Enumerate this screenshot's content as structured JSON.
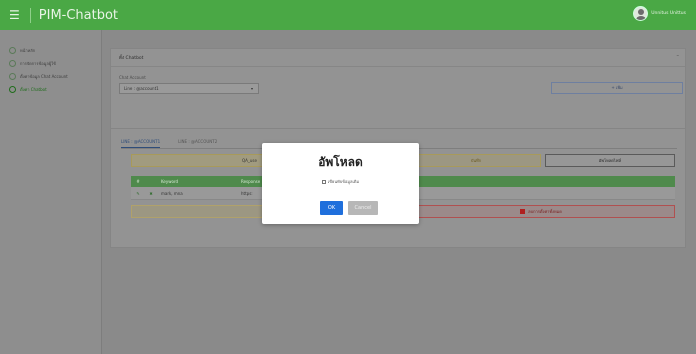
{
  "topbar": {
    "menu_icon": "☰",
    "brand": "PIM-Chatbot",
    "user_name": "Unnitus Unittus"
  },
  "sidebar": {
    "items": [
      {
        "label": "หน้าหลัก",
        "icon": "home-icon"
      },
      {
        "label": "การจัดการข้อมูลผู้ใช้",
        "icon": "users-icon"
      },
      {
        "label": "ตั้งค่าข้อมูล Chat Account",
        "icon": "settings-icon"
      },
      {
        "label": "ตั้งค่า Chatbot",
        "icon": "settings-icon"
      }
    ]
  },
  "card1": {
    "title": "ตั้ง Chatbot",
    "collapse": "–",
    "account_label": "Chat Account",
    "account_value": "Line : @account1",
    "account_chevron": "▾",
    "add_button": "+ เพิ่ม"
  },
  "card2": {
    "tabs": [
      "LINE : @ACCOUNT1",
      "LINE : @ACCOUNT2"
    ],
    "qa_label": "QA_use",
    "save_top": "บันทึก",
    "upload_top": "อัพโหลดไฟล์",
    "table": {
      "headers": [
        "#",
        "",
        "Keyword",
        "Response"
      ],
      "rows": [
        {
          "edit": "✎",
          "del": "✖",
          "keyword": "mark, mna",
          "response": "https:"
        }
      ]
    },
    "save_bottom": "บันทึก",
    "delete_button": "ลบการตั้งค่าทั้งหมด"
  },
  "modal": {
    "title": "อัพโหลด",
    "checkbox_label": "เขียนทับข้อมูลเดิม",
    "ok": "OK",
    "cancel": "Cancel"
  }
}
